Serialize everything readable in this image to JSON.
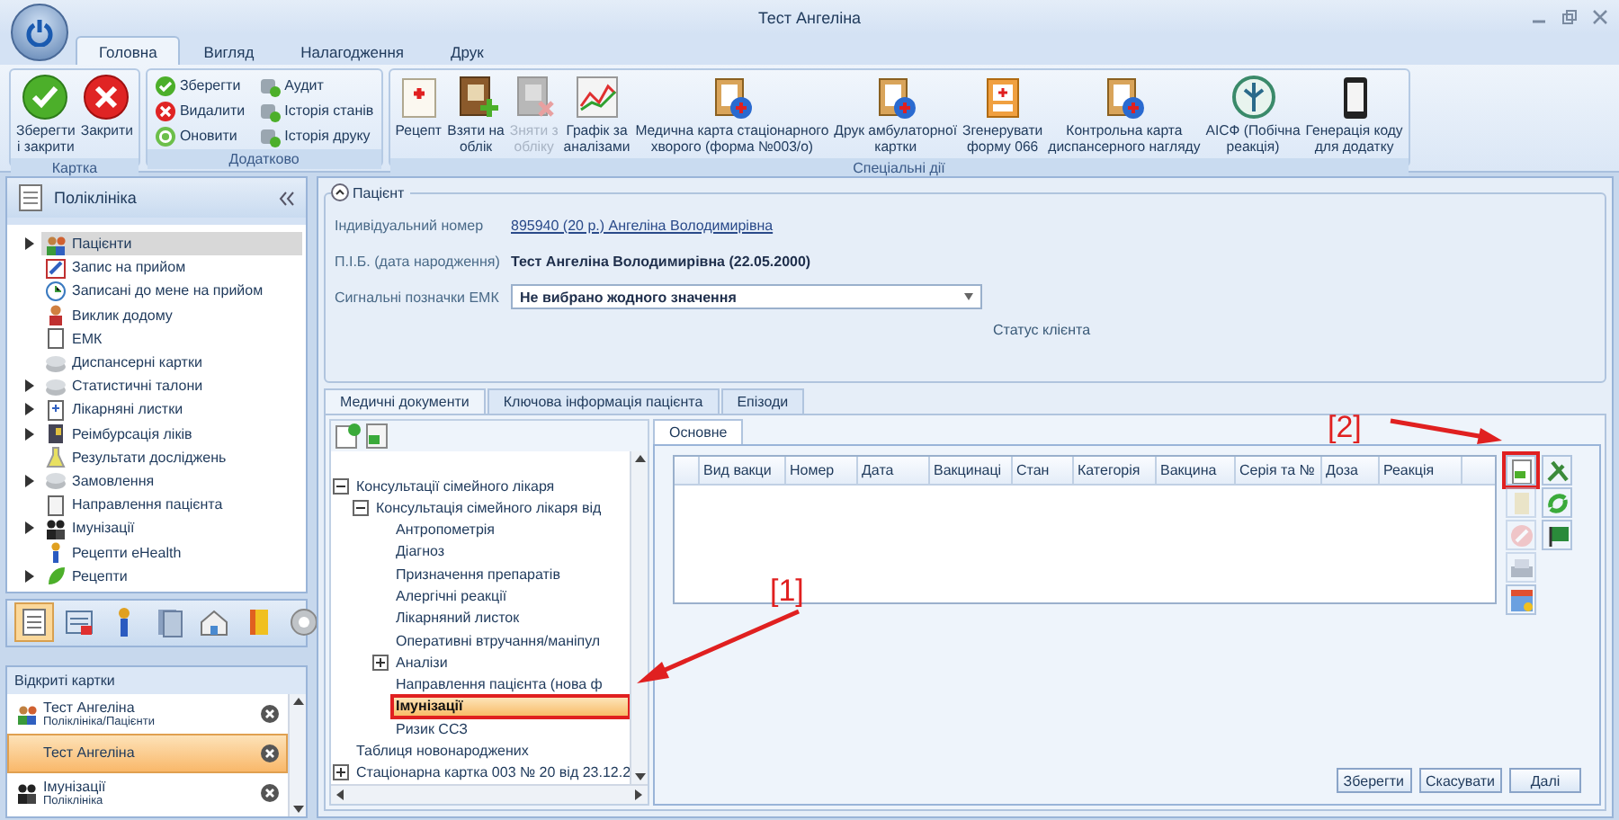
{
  "window": {
    "title": "Тест Ангеліна"
  },
  "ribbon_tabs": [
    {
      "label": "Головна",
      "selected": true
    },
    {
      "label": "Вигляд",
      "selected": false
    },
    {
      "label": "Налагодження",
      "selected": false
    },
    {
      "label": "Друк",
      "selected": false
    }
  ],
  "ribbon_groups": [
    {
      "label": "Картка",
      "kind": "large",
      "buttons": [
        {
          "label": "Зберегти\nі закрити",
          "disabled": false
        },
        {
          "label": "Закрити",
          "disabled": false
        }
      ]
    },
    {
      "label": "Додатково",
      "kind": "small",
      "buttons": [
        {
          "label": "Зберегти",
          "disabled": false
        },
        {
          "label": "Видалити",
          "disabled": false
        },
        {
          "label": "Оновити",
          "disabled": false
        },
        {
          "label": "Аудит",
          "disabled": false
        },
        {
          "label": "Історія станів",
          "disabled": false
        },
        {
          "label": "Історія друку",
          "disabled": false
        }
      ]
    },
    {
      "label": "Спеціальні дії",
      "kind": "large",
      "buttons": [
        {
          "label": "Рецепт",
          "disabled": false
        },
        {
          "label": "Взяти на\nоблік",
          "disabled": false
        },
        {
          "label": "Зняти з\nобліку",
          "disabled": true
        },
        {
          "label": "Графік за\nаналізами",
          "disabled": false
        },
        {
          "label": "Медична карта стаціонарного\nхворого (форма №003/о)",
          "disabled": false
        },
        {
          "label": "Друк амбулаторної\nкартки",
          "disabled": false
        },
        {
          "label": "Згенерувати\nформу 066",
          "disabled": false
        },
        {
          "label": "Контрольна карта\nдиспансерного нагляду",
          "disabled": false
        },
        {
          "label": "АІСФ (Побічна\nреакція)",
          "disabled": false
        },
        {
          "label": "Генерація коду\nдля додатку",
          "disabled": false
        }
      ]
    }
  ],
  "sidebar": {
    "title": "Поліклініка",
    "items": [
      {
        "label": "Пацієнти",
        "has_children": true,
        "selected": true
      },
      {
        "label": "Запис на прийом",
        "has_children": false,
        "selected": false
      },
      {
        "label": "Записані до мене на прийом",
        "has_children": false,
        "selected": false
      },
      {
        "label": "Виклик додому",
        "has_children": false,
        "selected": false
      },
      {
        "label": "ЕМК",
        "has_children": false,
        "selected": false
      },
      {
        "label": "Диспансерні картки",
        "has_children": false,
        "selected": false
      },
      {
        "label": "Статистичні талони",
        "has_children": true,
        "selected": false
      },
      {
        "label": "Лікарняні листки",
        "has_children": true,
        "selected": false
      },
      {
        "label": "Реімбурсація ліків",
        "has_children": true,
        "selected": false
      },
      {
        "label": "Результати досліджень",
        "has_children": false,
        "selected": false
      },
      {
        "label": "Замовлення",
        "has_children": true,
        "selected": false
      },
      {
        "label": "Направлення пацієнта",
        "has_children": false,
        "selected": false
      },
      {
        "label": "Імунізації",
        "has_children": true,
        "selected": false
      },
      {
        "label": "Рецепти eHealth",
        "has_children": false,
        "selected": false
      },
      {
        "label": "Рецепти",
        "has_children": true,
        "selected": false
      }
    ],
    "nav_buttons": [
      {
        "selected": true
      },
      {
        "selected": false
      },
      {
        "selected": false
      },
      {
        "selected": false
      },
      {
        "selected": false
      },
      {
        "selected": false
      },
      {
        "selected": false
      }
    ],
    "open_cards_title": "Відкриті картки",
    "open_cards": [
      {
        "title": "Тест Ангеліна",
        "subtitle": "Поліклініка/Пацієнти",
        "selected": false
      },
      {
        "title": "Тест Ангеліна",
        "selected": true
      },
      {
        "title": "Імунізації",
        "subtitle": "Поліклініка",
        "selected": false
      }
    ]
  },
  "patient": {
    "title": "Пацієнт",
    "fields": [
      {
        "label": "Індивідуальний номер",
        "value": "895940 (20 р.) Ангеліна Володимирівна",
        "kind": "link"
      },
      {
        "label": "П.І.Б. (дата народження)",
        "value": "Тест Ангеліна Володимирівна (22.05.2000)",
        "kind": "bold"
      },
      {
        "label": "Сигнальні позначки ЕМК",
        "value": "Не вибрано жодного значення",
        "kind": "select"
      }
    ],
    "status_label": "Статус клієнта"
  },
  "doc_tabs": [
    {
      "label": "Медичні документи",
      "selected": true
    },
    {
      "label": "Ключова інформація пацієнта",
      "selected": false
    },
    {
      "label": "Епізоди",
      "selected": false
    }
  ],
  "doc_tree": [
    {
      "label": "Консультації сімейного лікаря",
      "has_children": true,
      "expanded": true,
      "selected": false,
      "marked": false,
      "children": [
        {
          "label": "Консультація сімейного лікаря від",
          "has_children": true,
          "expanded": true,
          "selected": false,
          "marked": false,
          "children": [
            {
              "label": "Антропометрія",
              "has_children": false,
              "selected": false,
              "marked": false
            },
            {
              "label": "Діагноз",
              "has_children": false,
              "selected": false,
              "marked": false
            },
            {
              "label": "Призначення препаратів",
              "has_children": false,
              "selected": false,
              "marked": false
            },
            {
              "label": "Алергічні реакції",
              "has_children": false,
              "selected": false,
              "marked": false
            },
            {
              "label": "Лікарняний листок",
              "has_children": false,
              "selected": false,
              "marked": false
            },
            {
              "label": "Оперативні втручання/маніпул",
              "has_children": false,
              "selected": false,
              "marked": false
            },
            {
              "label": "Аналізи",
              "has_children": true,
              "expanded": false,
              "selected": false,
              "marked": false
            },
            {
              "label": "Направлення пацієнта (нова ф",
              "has_children": false,
              "selected": false,
              "marked": false
            },
            {
              "label": "Імунізації",
              "has_children": false,
              "selected": true,
              "marked": true
            },
            {
              "label": "Ризик ССЗ",
              "has_children": false,
              "selected": false,
              "marked": false
            }
          ]
        }
      ]
    },
    {
      "label": "Таблиця новонароджених",
      "has_children": false,
      "selected": false,
      "marked": false
    },
    {
      "label": "Стаціонарна картка 003 № 20 від 23.12.2",
      "has_children": true,
      "expanded": false,
      "selected": false,
      "marked": false
    }
  ],
  "detail_tabs": [
    {
      "label": "Основне",
      "selected": true
    }
  ],
  "table": {
    "columns": [
      "Вид вакци",
      "Номер",
      "Дата",
      "Вакцинаці",
      "Стан",
      "Категорія",
      "Вакцина",
      "Серія та №",
      "Доза",
      "Реакція"
    ]
  },
  "side_tools": {
    "left": [
      {
        "disabled": false,
        "marked": true
      },
      {
        "disabled": true,
        "marked": false
      },
      {
        "disabled": true,
        "marked": false
      },
      {
        "disabled": true,
        "marked": false
      },
      {
        "disabled": false,
        "marked": false
      }
    ],
    "right": [
      {
        "disabled": false,
        "marked": false
      },
      {
        "disabled": false,
        "marked": false
      },
      {
        "disabled": false,
        "marked": false
      }
    ]
  },
  "buttons": [
    "Зберегти",
    "Скасувати",
    "Далі"
  ],
  "annotations": [
    {
      "label": "[1]"
    },
    {
      "label": "[2]"
    }
  ]
}
